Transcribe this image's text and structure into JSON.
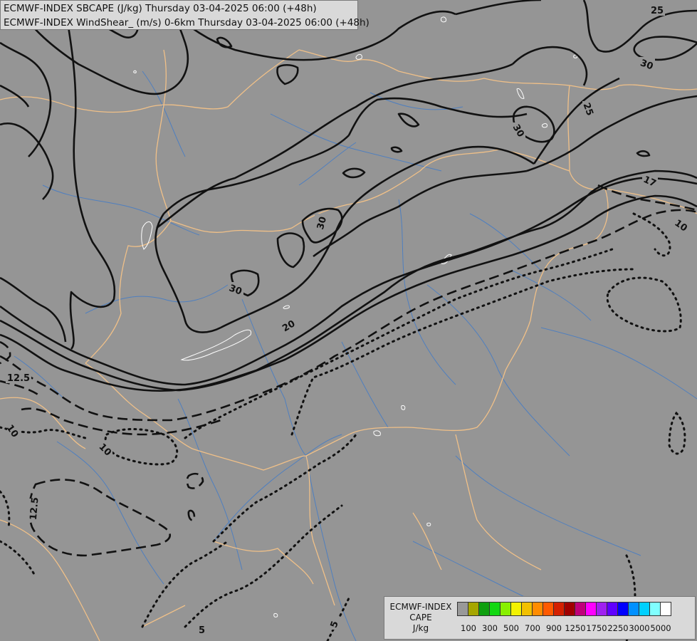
{
  "title": {
    "line1": "ECMWF-INDEX SBCAPE (J/kg) Thursday 03-04-2025 06:00 (+48h)",
    "line2": "ECMWF-INDEX WindShear_ (m/s) 0-6km Thursday 03-04-2025 06:00 (+48h)"
  },
  "legend": {
    "line1": "ECMWF-INDEX",
    "line2": "CAPE",
    "line3": "J/kg",
    "colors": [
      "#999999",
      "#a6a600",
      "#0f9f0f",
      "#12d812",
      "#88f000",
      "#f2f200",
      "#f2c000",
      "#ff8c00",
      "#ff5a00",
      "#d42000",
      "#a00000",
      "#c0007a",
      "#ff00ff",
      "#a020f0",
      "#6000ff",
      "#0000ff",
      "#0090ff",
      "#00d0ff",
      "#80ffff",
      "#ffffff"
    ],
    "ticks": [
      "100",
      "300",
      "500",
      "700",
      "900",
      "1250",
      "1750",
      "2250",
      "3000",
      "5000"
    ]
  },
  "contour_labels": {
    "l25a": "25",
    "l30a": "30",
    "l25b": "25",
    "l30b": "30",
    "l17": "17",
    "l10a": "10",
    "l30c": "30",
    "l30d": "30",
    "l20": "20",
    "l125a": "12.5",
    "l10b": "10",
    "l10c": "10",
    "l125b": "12.5",
    "l5a": "5",
    "l5b": "5"
  },
  "colors": {
    "background": "#959595",
    "border": "#f0c088",
    "river": "#4f7fbf",
    "contour": "#111111",
    "lake": "#ffffff"
  }
}
